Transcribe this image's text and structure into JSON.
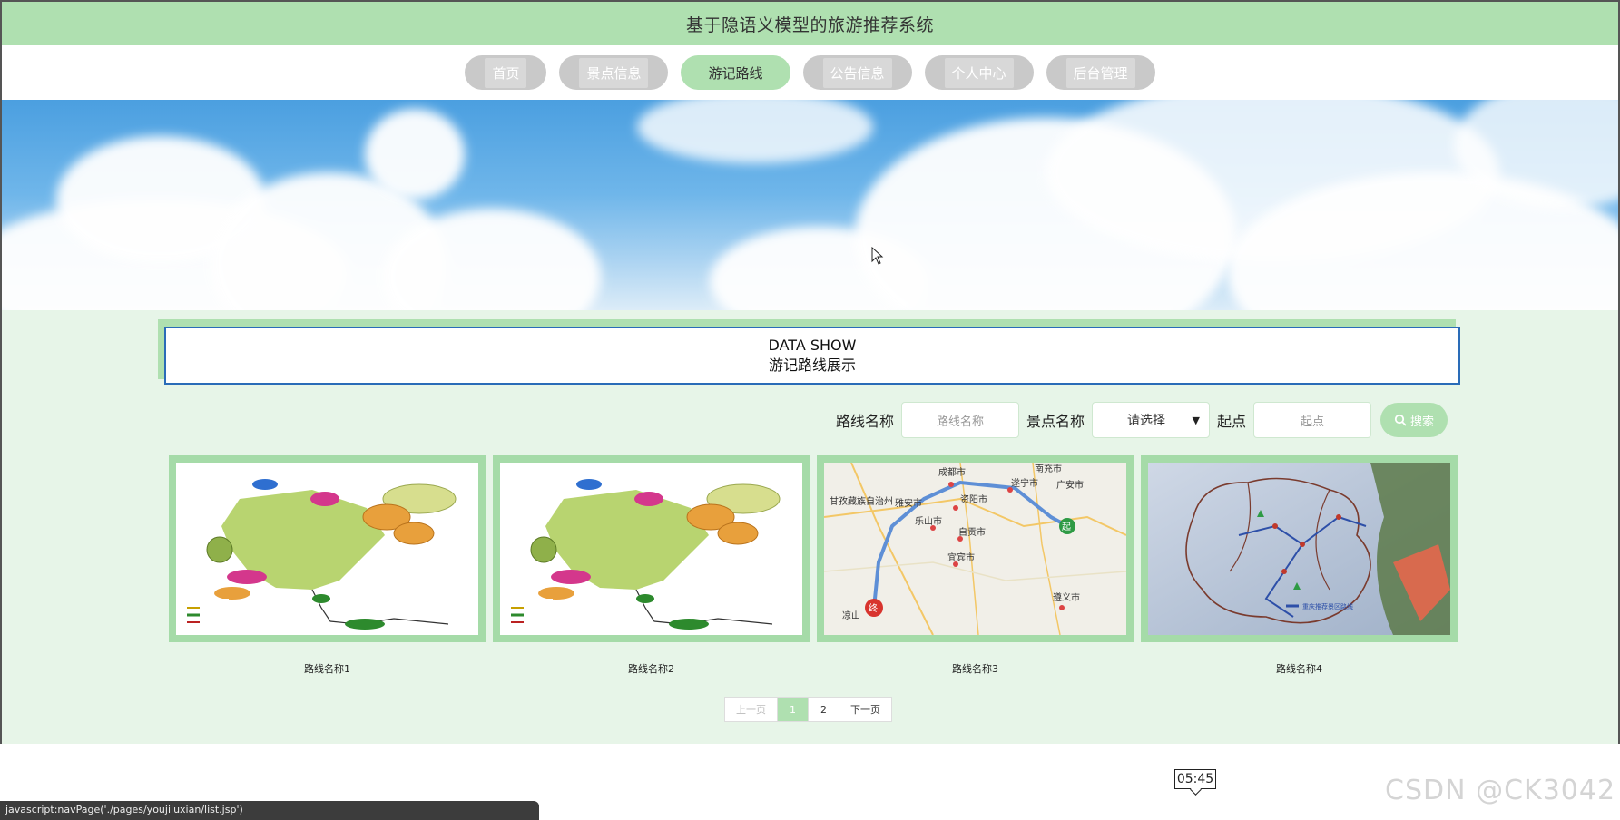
{
  "header": {
    "title": "基于隐语义模型的旅游推荐系统"
  },
  "nav": {
    "items": [
      {
        "label": "首页",
        "active": false
      },
      {
        "label": "景点信息",
        "active": false
      },
      {
        "label": "游记路线",
        "active": true
      },
      {
        "label": "公告信息",
        "active": false
      },
      {
        "label": "个人中心",
        "active": false
      },
      {
        "label": "后台管理",
        "active": false
      }
    ]
  },
  "section": {
    "title_en": "DATA SHOW",
    "title_cn": "游记路线展示"
  },
  "search": {
    "route_label": "路线名称",
    "route_placeholder": "路线名称",
    "scenic_label": "景点名称",
    "scenic_selected": "请选择",
    "start_label": "起点",
    "start_placeholder": "起点",
    "button_label": "搜索"
  },
  "cards": [
    {
      "name": "路线名称1",
      "image": "scenic-area-map"
    },
    {
      "name": "路线名称2",
      "image": "scenic-area-map"
    },
    {
      "name": "路线名称3",
      "image": "road-route-map"
    },
    {
      "name": "路线名称4",
      "image": "hand-drawn-route-map"
    }
  ],
  "map_labels": {
    "chengdu": "成都市",
    "nanchong": "南充市",
    "suining": "遂宁市",
    "guangan": "广安市",
    "ganzi": "甘孜藏族自治州",
    "yaan": "雅安市",
    "ziyang": "资阳市",
    "leshan": "乐山市",
    "zigong": "自贡市",
    "yibin": "宜宾市",
    "liangshan": "凉山",
    "zunyi": "遵义市",
    "qi": "起",
    "zhong": "终"
  },
  "route4_caption": "重庆推荐景区路线",
  "pagination": {
    "prev": "上一页",
    "pages": [
      "1",
      "2"
    ],
    "current": "1",
    "next": "下一页"
  },
  "tooltip": {
    "time": "05:45"
  },
  "status_bar": {
    "text": "javascript:navPage('./pages/youjiluxian/list.jsp')"
  },
  "watermark": {
    "text": "CSDN @CK3042"
  },
  "colors": {
    "accent": "#afe0b0",
    "card_frame": "#a5dba8",
    "content_bg": "#e7f5e8",
    "section_border": "#2a6cb8"
  }
}
